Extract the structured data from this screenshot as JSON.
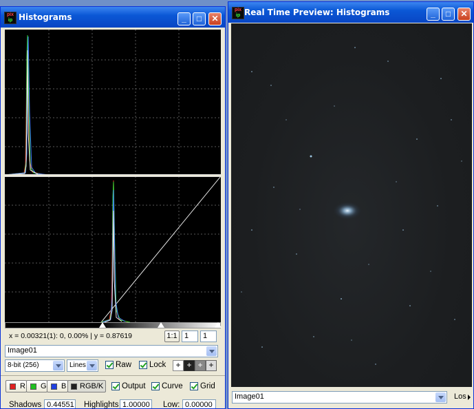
{
  "histogram_window": {
    "title": "Histograms",
    "app_icon_text": [
      "pix",
      "ip"
    ],
    "readout": "x = 0.00321(1): 0, 0.00% | y = 0.87619",
    "zoom_button": "1:1",
    "zoom_h": "1",
    "zoom_v": "1",
    "image_select": "Image01",
    "bit_select": "8-bit (256)",
    "style_select": "Lines",
    "raw_label": "Raw",
    "raw_checked": true,
    "lock_label": "Lock",
    "lock_checked": true,
    "channels": [
      {
        "label": "R",
        "color": "#e02020"
      },
      {
        "label": "G",
        "color": "#20c020"
      },
      {
        "label": "B",
        "color": "#2040e0"
      },
      {
        "label": "RGB/K",
        "color": "#202020"
      }
    ],
    "output_label": "Output",
    "curve_label": "Curve",
    "grid_label": "Grid",
    "shadows_label": "Shadows",
    "shadows_value": "0.44551",
    "highlights_label": "Highlights",
    "highlights_value": "1.00000",
    "low_label": "Low:",
    "low_value": "0.00000"
  },
  "preview_window": {
    "title": "Real Time Preview: Histograms",
    "image_select": "Image01",
    "right_label": "Los"
  },
  "colors": {
    "title_blue": "#0b58d6",
    "plot_bg": "#000000",
    "preview_bg": "#1b1d1f"
  }
}
